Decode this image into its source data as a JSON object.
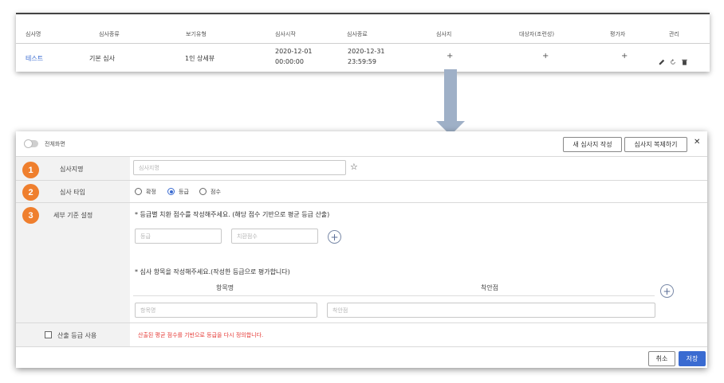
{
  "top_table": {
    "headers": [
      "심사명",
      "심사종류",
      "보기유형",
      "심사시작",
      "심사종료",
      "심사지",
      "대상자(조련성)",
      "평가자",
      "관리"
    ],
    "row": {
      "name": "테스트",
      "type": "기본 심사",
      "view_type": "1인 상세뷰",
      "start_date": "2020-12-01",
      "start_time": "00:00:00",
      "end_date": "2020-12-31",
      "end_time": "23:59:59",
      "sheet_plus": "+",
      "target_plus": "+",
      "evaluator_plus": "+"
    },
    "manage_icons": [
      "pencil-icon",
      "refresh-icon",
      "trash-icon"
    ]
  },
  "modal": {
    "fullscreen_label": "전체화면",
    "new_sheet_button": "새 심사지 작성",
    "copy_sheet_button": "심사지 복제하기",
    "close_symbol": "✕",
    "rows": [
      {
        "number": "1",
        "label": "심사지명",
        "input_placeholder": "심사지명",
        "star": "☆"
      },
      {
        "number": "2",
        "label": "심사 타입",
        "options": [
          "확정",
          "등급",
          "점수"
        ],
        "selected": "등급"
      },
      {
        "number": "3",
        "label": "세부 기준 설정"
      }
    ],
    "grade_note": "* 등급별 치환 점수를 작성해주세요. (해당 점수 기반으로 평균 등급 산출)",
    "grade_placeholder": "등급",
    "score_placeholder": "치환점수",
    "item_note": "* 심사 항목을 작성해주세요.(작성한 등급으로 평가합니다)",
    "item_col_header": "항목명",
    "focus_col_header": "착안점",
    "item_placeholder": "항목명",
    "focus_placeholder": "착안점",
    "plus_symbol": "+",
    "calc_grade_label": "산출 등급 사용",
    "calc_grade_note": "산출된 평균 점수를 기반으로 등급을 다시 정의합니다.",
    "cancel_button": "취소",
    "save_button": "저장"
  },
  "colors": {
    "accent": "#3a6bd1",
    "badge": "#ef7f2e",
    "warning_text": "#e53935",
    "arrow": "#9fb0c7",
    "label_bg": "#f2f2f2"
  }
}
